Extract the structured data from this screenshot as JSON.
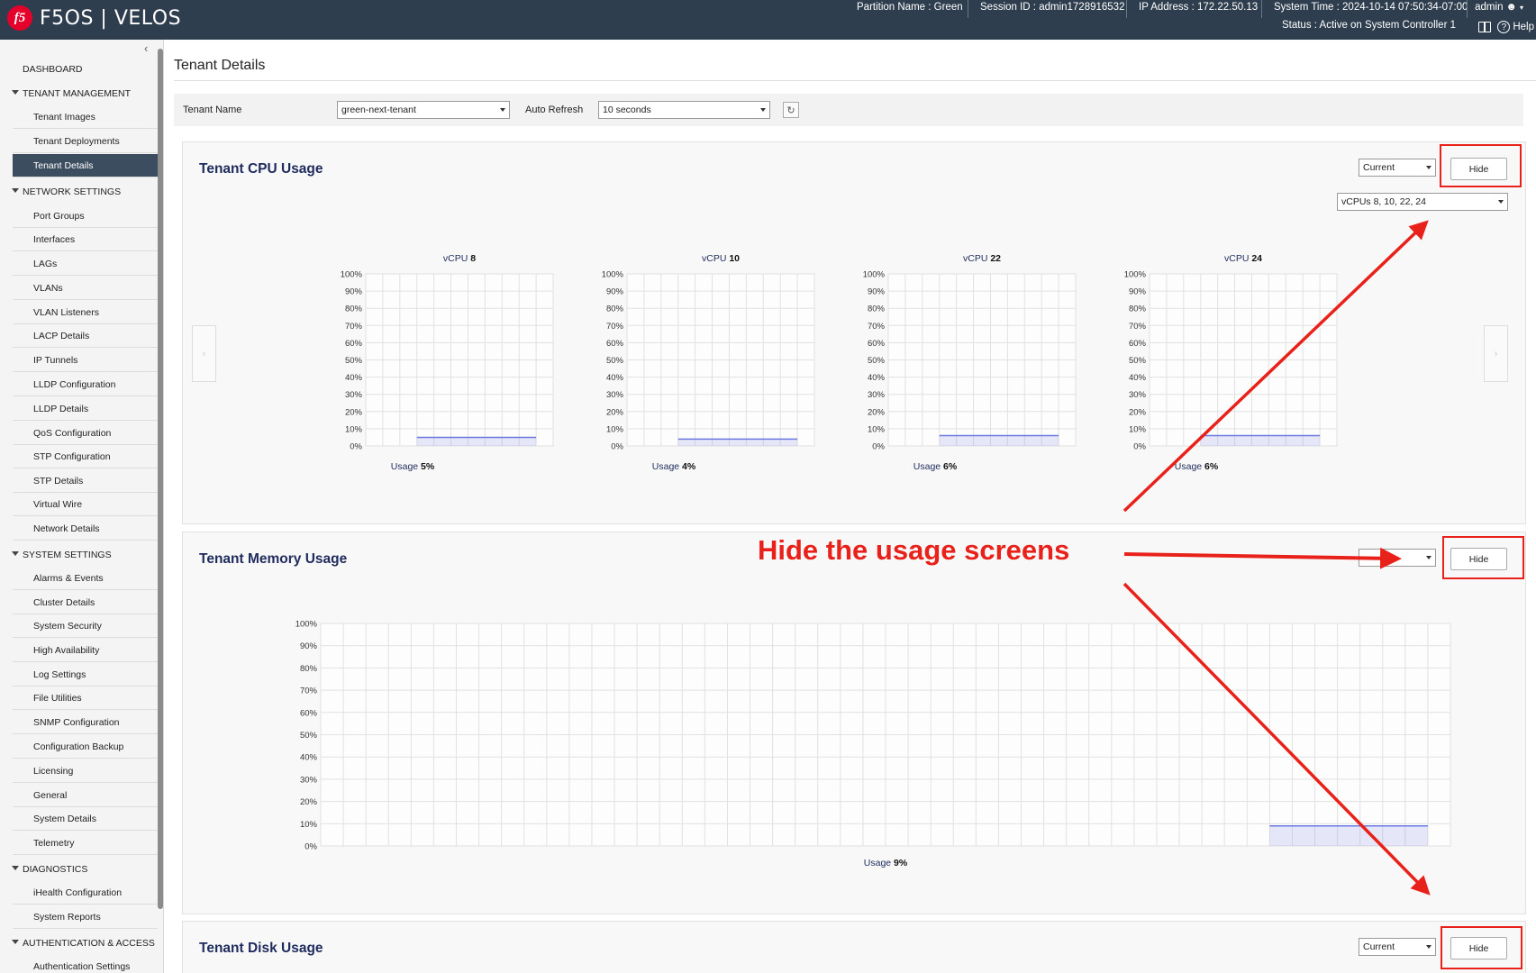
{
  "header": {
    "app_title": "F5OS | VELOS",
    "logo": "f5",
    "partition": "Partition Name : Green",
    "session": "Session ID : admin1728916532",
    "ip": "IP Address : 172.22.50.13",
    "system_time": "System Time : 2024-10-14 07:50:34-07:00",
    "user": "admin",
    "status": "Status : Active on System Controller 1",
    "help": "Help"
  },
  "sidebar": {
    "dashboard": "DASHBOARD",
    "tenant_management": "TENANT MANAGEMENT",
    "tenant_images": "Tenant Images",
    "tenant_deployments": "Tenant Deployments",
    "tenant_details": "Tenant Details",
    "network_settings": "NETWORK SETTINGS",
    "port_groups": "Port Groups",
    "interfaces": "Interfaces",
    "lags": "LAGs",
    "vlans": "VLANs",
    "vlan_listeners": "VLAN Listeners",
    "lacp_details": "LACP Details",
    "ip_tunnels": "IP Tunnels",
    "lldp_configuration": "LLDP Configuration",
    "lldp_details": "LLDP Details",
    "qos_configuration": "QoS Configuration",
    "stp_configuration": "STP Configuration",
    "stp_details": "STP Details",
    "virtual_wire": "Virtual Wire",
    "network_details": "Network Details",
    "system_settings": "SYSTEM SETTINGS",
    "alarms_events": "Alarms & Events",
    "cluster_details": "Cluster Details",
    "system_security": "System Security",
    "high_availability": "High Availability",
    "log_settings": "Log Settings",
    "file_utilities": "File Utilities",
    "snmp_configuration": "SNMP Configuration",
    "configuration_backup": "Configuration Backup",
    "licensing": "Licensing",
    "general": "General",
    "system_details": "System Details",
    "telemetry": "Telemetry",
    "diagnostics": "DIAGNOSTICS",
    "ihealth_configuration": "iHealth Configuration",
    "system_reports": "System Reports",
    "authentication_access": "AUTHENTICATION & ACCESS",
    "authentication_settings": "Authentication Settings"
  },
  "main": {
    "page_title": "Tenant Details",
    "tenant_name_label": "Tenant Name",
    "tenant_name_value": "green-next-tenant",
    "auto_refresh_label": "Auto Refresh",
    "auto_refresh_value": "10 seconds",
    "cpu_panel": {
      "title": "Tenant CPU Usage",
      "period": "Current",
      "hide": "Hide",
      "vcpu_select": "vCPUs 8, 10, 22, 24"
    },
    "memory_panel": {
      "title": "Tenant Memory Usage",
      "hide": "Hide"
    },
    "disk_panel": {
      "title": "Tenant Disk Usage",
      "period": "Current",
      "hide": "Hide"
    }
  },
  "annotation": {
    "text": "Hide the usage screens"
  },
  "colors": {
    "header_bg": "#2f3e4e",
    "active_nav": "#3d4d60",
    "panel_title": "#1e2b5c",
    "usage_line": "#6a78e0",
    "annotation_red": "#e8221b"
  },
  "chart_data": [
    {
      "type": "area",
      "label_prefix": "vCPU",
      "label_number": "8",
      "usage_label": "Usage",
      "usage_value": "5%",
      "y_ticks": [
        "100%",
        "90%",
        "80%",
        "70%",
        "60%",
        "50%",
        "40%",
        "30%",
        "20%",
        "10%",
        "0%"
      ],
      "ylim": [
        0,
        100
      ],
      "series": [
        {
          "values": [
            5,
            5,
            5,
            5,
            5,
            5,
            5,
            5
          ]
        }
      ],
      "start_index": 3,
      "total_points": 11
    },
    {
      "type": "area",
      "label_prefix": "vCPU",
      "label_number": "10",
      "usage_label": "Usage",
      "usage_value": "4%",
      "y_ticks": [
        "100%",
        "90%",
        "80%",
        "70%",
        "60%",
        "50%",
        "40%",
        "30%",
        "20%",
        "10%",
        "0%"
      ],
      "ylim": [
        0,
        100
      ],
      "series": [
        {
          "values": [
            4,
            4,
            4,
            4,
            4,
            4,
            4,
            4
          ]
        }
      ],
      "start_index": 3,
      "total_points": 11
    },
    {
      "type": "area",
      "label_prefix": "vCPU",
      "label_number": "22",
      "usage_label": "Usage",
      "usage_value": "6%",
      "y_ticks": [
        "100%",
        "90%",
        "80%",
        "70%",
        "60%",
        "50%",
        "40%",
        "30%",
        "20%",
        "10%",
        "0%"
      ],
      "ylim": [
        0,
        100
      ],
      "series": [
        {
          "values": [
            6,
            6,
            6,
            6,
            6,
            6,
            6,
            6
          ]
        }
      ],
      "start_index": 3,
      "total_points": 11
    },
    {
      "type": "area",
      "label_prefix": "vCPU",
      "label_number": "24",
      "usage_label": "Usage",
      "usage_value": "6%",
      "y_ticks": [
        "100%",
        "90%",
        "80%",
        "70%",
        "60%",
        "50%",
        "40%",
        "30%",
        "20%",
        "10%",
        "0%"
      ],
      "ylim": [
        0,
        100
      ],
      "series": [
        {
          "values": [
            6,
            6,
            6,
            6,
            6,
            6,
            6,
            6
          ]
        }
      ],
      "start_index": 3,
      "total_points": 11
    },
    {
      "type": "area",
      "usage_label": "Usage",
      "usage_value": "9%",
      "y_ticks": [
        "100%",
        "90%",
        "80%",
        "70%",
        "60%",
        "50%",
        "40%",
        "30%",
        "20%",
        "10%",
        "0%"
      ],
      "ylim": [
        0,
        100
      ],
      "series": [
        {
          "values": [
            9,
            9,
            9,
            9,
            9,
            9,
            9,
            9
          ]
        }
      ],
      "start_index": 42,
      "total_points": 50
    }
  ]
}
